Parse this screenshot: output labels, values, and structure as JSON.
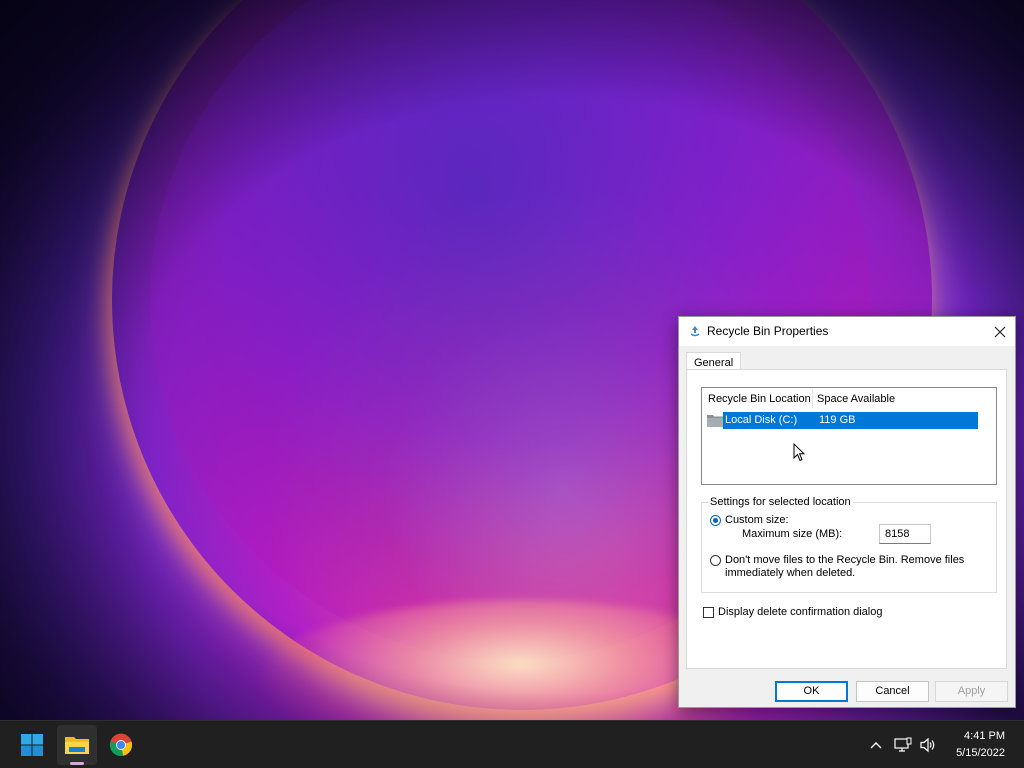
{
  "dialog": {
    "title": "Recycle Bin Properties",
    "tab": "General",
    "list": {
      "columns": [
        "Recycle Bin Location",
        "Space Available"
      ],
      "rows": [
        {
          "location": "Local Disk (C:)",
          "space": "119 GB",
          "selected": true
        }
      ]
    },
    "settings": {
      "group_title": "Settings for selected location",
      "custom_size_label": "Custom size:",
      "custom_size_checked": true,
      "max_size_label": "Maximum size (MB):",
      "max_size_value": "8158",
      "no_move_label_line1": "Don't move files to the Recycle Bin. Remove files",
      "no_move_label_line2": "immediately when deleted.",
      "no_move_checked": false
    },
    "confirm_label": "Display delete confirmation dialog",
    "confirm_checked": false,
    "buttons": {
      "ok": "OK",
      "cancel": "Cancel",
      "apply": "Apply"
    }
  },
  "taskbar": {
    "apps": [
      {
        "name": "start",
        "icon": "windows-logo-icon"
      },
      {
        "name": "file-explorer",
        "icon": "folder-icon",
        "active": true
      },
      {
        "name": "chrome",
        "icon": "chrome-icon"
      }
    ],
    "tray": [
      "chevron-up-icon",
      "network-icon",
      "volume-icon"
    ],
    "time": "4:41 PM",
    "date": "5/15/2022"
  },
  "colors": {
    "selection": "#0078d7",
    "taskbar": "#202020",
    "accent": "#0067c0"
  }
}
